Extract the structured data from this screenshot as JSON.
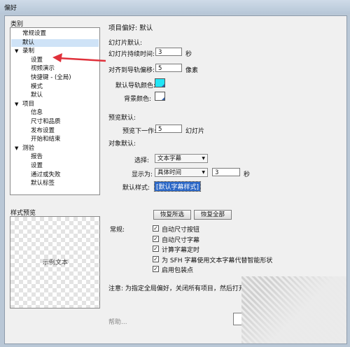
{
  "window": {
    "title": "偏好"
  },
  "category": {
    "label": "类别",
    "items": [
      {
        "label": "常规设置",
        "selected": false,
        "indent": 1,
        "arrow": ""
      },
      {
        "label": "默认",
        "selected": true,
        "indent": 1,
        "arrow": ""
      },
      {
        "label": "录制",
        "selected": false,
        "indent": 1,
        "arrow": "▼"
      },
      {
        "label": "设置",
        "selected": false,
        "indent": 2,
        "arrow": ""
      },
      {
        "label": "视频演示",
        "selected": false,
        "indent": 2,
        "arrow": ""
      },
      {
        "label": "快捷键 - (全局)",
        "selected": false,
        "indent": 2,
        "arrow": ""
      },
      {
        "label": "模式",
        "selected": false,
        "indent": 2,
        "arrow": ""
      },
      {
        "label": "默认",
        "selected": false,
        "indent": 2,
        "arrow": ""
      },
      {
        "label": "项目",
        "selected": false,
        "indent": 1,
        "arrow": "▼"
      },
      {
        "label": "信息",
        "selected": false,
        "indent": 2,
        "arrow": ""
      },
      {
        "label": "尺寸和品质",
        "selected": false,
        "indent": 2,
        "arrow": ""
      },
      {
        "label": "发布设置",
        "selected": false,
        "indent": 2,
        "arrow": ""
      },
      {
        "label": "开始和结束",
        "selected": false,
        "indent": 2,
        "arrow": ""
      },
      {
        "label": "测验",
        "selected": false,
        "indent": 1,
        "arrow": "▼"
      },
      {
        "label": "报告",
        "selected": false,
        "indent": 2,
        "arrow": ""
      },
      {
        "label": "设置",
        "selected": false,
        "indent": 2,
        "arrow": ""
      },
      {
        "label": "通过或失败",
        "selected": false,
        "indent": 2,
        "arrow": ""
      },
      {
        "label": "默认标签",
        "selected": false,
        "indent": 2,
        "arrow": ""
      }
    ]
  },
  "preview": {
    "label": "样式预览",
    "sample_text": "示例文本"
  },
  "panel": {
    "title": "项目偏好: 默认",
    "slide_defaults": "幻灯片默认:",
    "slide_duration_label": "幻灯片持续时间:",
    "slide_duration_value": "3",
    "slide_duration_unit": "秒",
    "snap_label": "对齐到导轨偏移:",
    "snap_value": "5",
    "snap_unit": "像素",
    "guide_color_label": "默认导轨颜色:",
    "guide_color": "#22e5f5",
    "bg_color_label": "背景颜色:",
    "bg_color": "#ffffff",
    "preview_defaults": "预览默认:",
    "preview_next_label": "预览下一作:",
    "preview_next_value": "5",
    "preview_next_unit": "幻灯片",
    "object_defaults": "对象默认:",
    "select_label": "选择:",
    "select_value": "文本字幕",
    "display_label": "显示为:",
    "display_value": "具体时间",
    "display_seconds": "3",
    "display_unit": "秒",
    "style_label": "默认样式:",
    "style_value": "[默认字幕样式]",
    "restore_selected": "恢复所选",
    "restore_all": "恢复全部",
    "general_label": "常规:",
    "options": [
      {
        "label": "自动尺寸按钮",
        "checked": true
      },
      {
        "label": "自动尺寸字幕",
        "checked": true
      },
      {
        "label": "计算字幕定时",
        "checked": true
      },
      {
        "label": "为 SFH 字幕使用文本字幕代替智能形状",
        "checked": true
      },
      {
        "label": "启用包装点",
        "checked": true
      }
    ],
    "note": "注意: 为指定全局偏好，关闭所有项目，然后打开偏好对话框。",
    "help": "帮助..."
  }
}
